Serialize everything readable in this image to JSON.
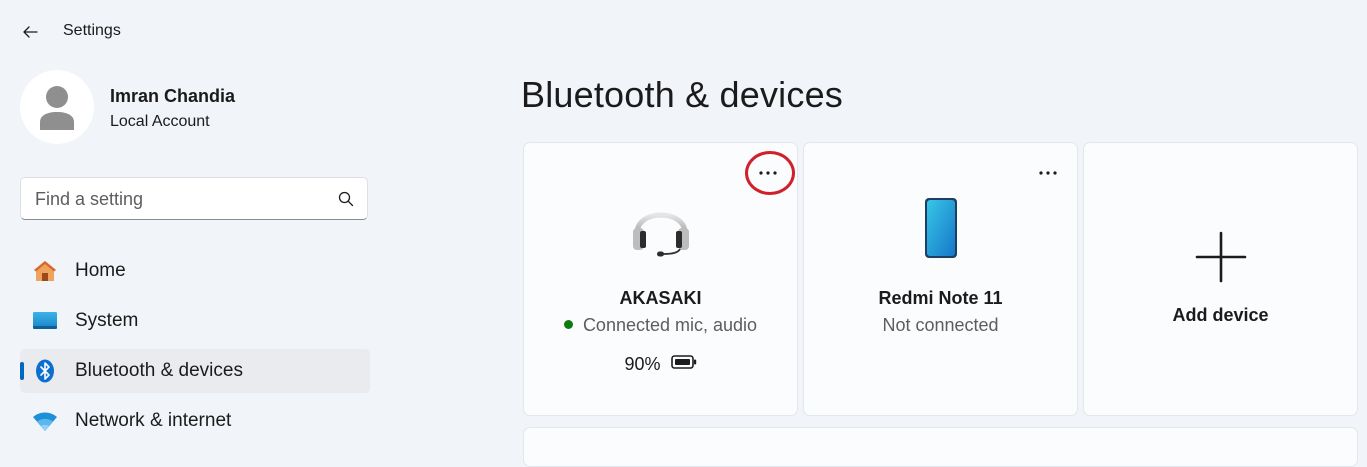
{
  "app": {
    "title": "Settings"
  },
  "profile": {
    "name": "Imran Chandia",
    "account_type": "Local Account"
  },
  "search": {
    "placeholder": "Find a setting"
  },
  "sidebar": {
    "items": [
      {
        "label": "Home",
        "icon": "home-icon",
        "selected": false
      },
      {
        "label": "System",
        "icon": "system-icon",
        "selected": false
      },
      {
        "label": "Bluetooth & devices",
        "icon": "bluetooth-icon",
        "selected": true
      },
      {
        "label": "Network & internet",
        "icon": "wifi-icon",
        "selected": false
      }
    ]
  },
  "main": {
    "title": "Bluetooth & devices",
    "devices": [
      {
        "name": "AKASAKI",
        "icon": "headset-icon",
        "status": "Connected mic, audio",
        "connected": true,
        "battery": "90%",
        "more_label": "..."
      },
      {
        "name": "Redmi Note 11",
        "icon": "phone-icon",
        "status": "Not connected",
        "connected": false,
        "more_label": "..."
      }
    ],
    "add_device_label": "Add device"
  },
  "colors": {
    "accent": "#0067c0",
    "status_connected": "#0f7b0f",
    "highlight": "#d0202a",
    "background": "#f1f4f9"
  }
}
